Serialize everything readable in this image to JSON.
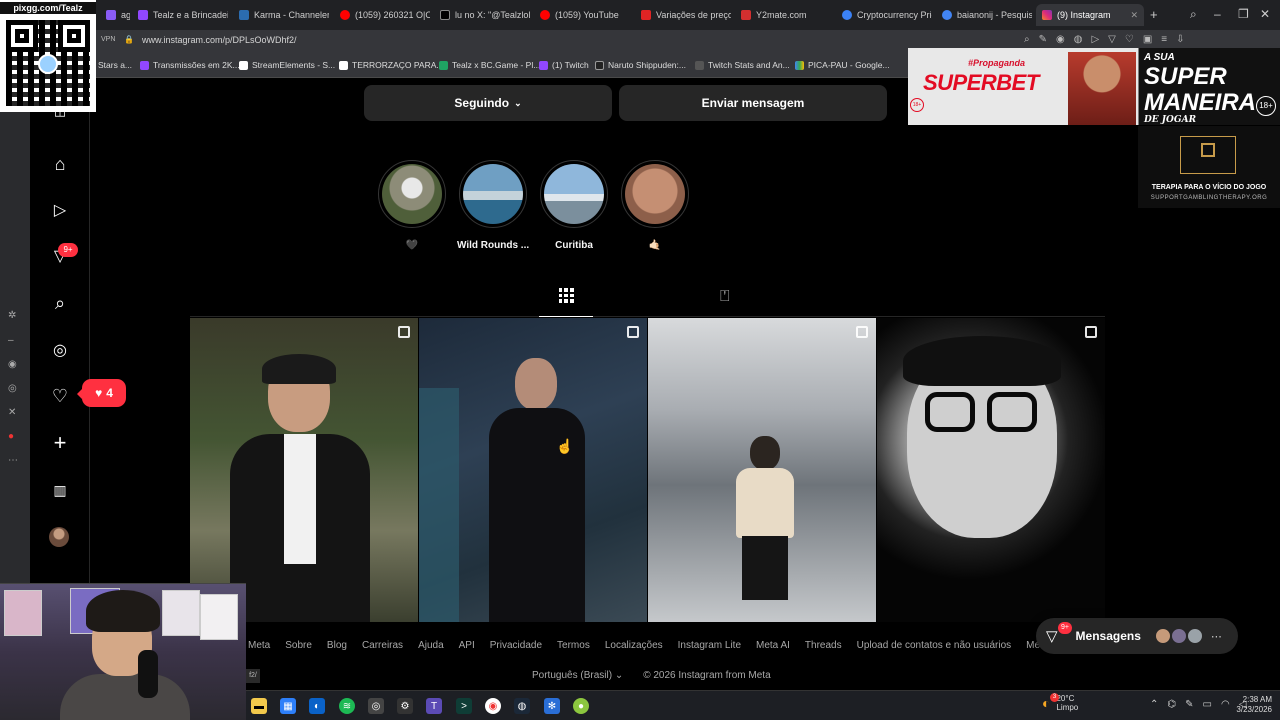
{
  "browser": {
    "tabs": [
      {
        "label": "agic of",
        "color": "#8a5cf6"
      },
      {
        "label": "Tealz e a Brincadeira",
        "color": "#9147ff"
      },
      {
        "label": "Karma - Channeler",
        "color": "#2b6cb0"
      },
      {
        "label": "(1059) 260321 O|O|",
        "color": "#ff0000"
      },
      {
        "label": "lu no X: \"@Tealzlol",
        "color": "#000000"
      },
      {
        "label": "(1059) YouTube",
        "color": "#ff0000"
      },
      {
        "label": "Variações de preços",
        "color": "#e02424"
      },
      {
        "label": "Y2mate.com",
        "color": "#d32f2f"
      },
      {
        "label": "Cryptocurrency Price",
        "color": "#3b82f6"
      },
      {
        "label": "baianonij - Pesquisa",
        "color": "#4285f4"
      },
      {
        "label": "(9) Instagram",
        "color": "#e1306c"
      }
    ],
    "url": "www.instagram.com/p/DPLsOoWDhf2/",
    "vpn": "VPN",
    "bookmarks": [
      "Stars a...",
      "Transmissões em 2K...",
      "StreamElements - S...",
      "TERRORZAÇO PARA...",
      "Tealz x BC.Game - Pl...",
      "(1) Twitch",
      "Naruto Shippuden:...",
      "Twitch Stats and An...",
      "PICA-PAU - Google..."
    ]
  },
  "overlay": {
    "qr_title": "pixgg.com/Tealz",
    "ad_tag": "#Propaganda",
    "ad_brand": "SUPERBET",
    "ad_headline_1": "A SUA",
    "ad_headline_2": "SUPER",
    "ad_headline_3": "MANEIRA",
    "ad_headline_4": "DE JOGAR",
    "ad_age": "18+",
    "therapy_title": "TERAPIA PARA O VÍCIO DO JOGO",
    "therapy_url": "SUPPORTGAMBLINGTHERAPY.ORG"
  },
  "instagram": {
    "buttons": {
      "following": "Seguindo",
      "message": "Enviar mensagem"
    },
    "highlights": [
      {
        "label": "🖤",
        "color": "#8d8c78"
      },
      {
        "label": "Wild Rounds ...",
        "color": "#6f9fc3"
      },
      {
        "label": "Curitiba",
        "color": "#8fb7db"
      },
      {
        "label": "🤙🏻",
        "color": "#c58f73"
      }
    ],
    "sidebar_badge": "9+",
    "notification_count": "4",
    "footer_links": [
      "Meta",
      "Sobre",
      "Blog",
      "Carreiras",
      "Ajuda",
      "API",
      "Privacidade",
      "Termos",
      "Localizações",
      "Instagram Lite",
      "Meta AI",
      "Threads",
      "Upload de contatos e não usuários",
      "Meta Veri"
    ],
    "language": "Português (Brasil)",
    "copyright": "© 2026 Instagram from Meta",
    "messages": {
      "label": "Mensagens",
      "badge": "9+"
    }
  },
  "taskbar": {
    "weather_temp": "20°C",
    "weather_desc": "Limpo",
    "weather_badge": "3",
    "time": "2:38 AM",
    "date": "3/23/2026"
  }
}
